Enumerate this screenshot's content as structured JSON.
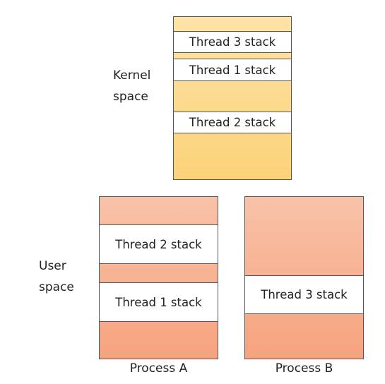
{
  "kernel": {
    "label_line1": "Kernel",
    "label_line2": "space",
    "stacks": [
      "Thread 3 stack",
      "Thread 1 stack",
      "Thread 2 stack"
    ]
  },
  "user": {
    "label_line1": "User",
    "label_line2": "space"
  },
  "processes": [
    {
      "name": "Process A",
      "stacks": [
        "Thread 2 stack",
        "Thread 1 stack"
      ]
    },
    {
      "name": "Process B",
      "stacks": [
        "Thread 3 stack"
      ]
    }
  ],
  "colors": {
    "kernel": "#fcd279",
    "user": "#f6a37e",
    "stack": "#ffffff"
  }
}
